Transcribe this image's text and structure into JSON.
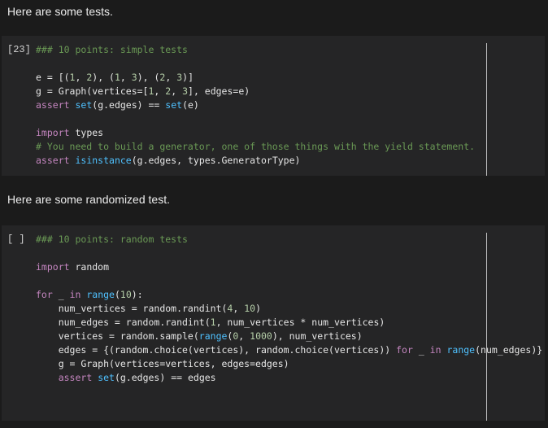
{
  "markdown_1": "Here are some tests.",
  "markdown_2": "Here are some randomized test.",
  "cell_1": {
    "prompt": "[23]",
    "lines": [
      [
        {
          "t": "### 10 points: simple tests",
          "c": "cm"
        }
      ],
      [],
      [
        {
          "t": "e = [(",
          "c": ""
        },
        {
          "t": "1",
          "c": "num"
        },
        {
          "t": ", ",
          "c": ""
        },
        {
          "t": "2",
          "c": "num"
        },
        {
          "t": "), (",
          "c": ""
        },
        {
          "t": "1",
          "c": "num"
        },
        {
          "t": ", ",
          "c": ""
        },
        {
          "t": "3",
          "c": "num"
        },
        {
          "t": "), (",
          "c": ""
        },
        {
          "t": "2",
          "c": "num"
        },
        {
          "t": ", ",
          "c": ""
        },
        {
          "t": "3",
          "c": "num"
        },
        {
          "t": ")]",
          "c": ""
        }
      ],
      [
        {
          "t": "g = Graph(vertices=[",
          "c": ""
        },
        {
          "t": "1",
          "c": "num"
        },
        {
          "t": ", ",
          "c": ""
        },
        {
          "t": "2",
          "c": "num"
        },
        {
          "t": ", ",
          "c": ""
        },
        {
          "t": "3",
          "c": "num"
        },
        {
          "t": "], edges=e)",
          "c": ""
        }
      ],
      [
        {
          "t": "assert",
          "c": "kw"
        },
        {
          "t": " ",
          "c": ""
        },
        {
          "t": "set",
          "c": "bi"
        },
        {
          "t": "(g.edges) == ",
          "c": ""
        },
        {
          "t": "set",
          "c": "bi"
        },
        {
          "t": "(e)",
          "c": ""
        }
      ],
      [],
      [
        {
          "t": "import",
          "c": "kw"
        },
        {
          "t": " types",
          "c": ""
        }
      ],
      [
        {
          "t": "# You need to build a generator, one of those things with the yield statement.",
          "c": "cm"
        }
      ],
      [
        {
          "t": "assert",
          "c": "kw"
        },
        {
          "t": " ",
          "c": ""
        },
        {
          "t": "isinstance",
          "c": "bi"
        },
        {
          "t": "(g.edges, types.GeneratorType)",
          "c": ""
        }
      ]
    ]
  },
  "cell_2": {
    "prompt": "[ ]",
    "lines": [
      [
        {
          "t": "### 10 points: random tests",
          "c": "cm"
        }
      ],
      [],
      [
        {
          "t": "import",
          "c": "kw"
        },
        {
          "t": " random",
          "c": ""
        }
      ],
      [],
      [
        {
          "t": "for",
          "c": "kw"
        },
        {
          "t": " _ ",
          "c": ""
        },
        {
          "t": "in",
          "c": "kw"
        },
        {
          "t": " ",
          "c": ""
        },
        {
          "t": "range",
          "c": "bi"
        },
        {
          "t": "(",
          "c": ""
        },
        {
          "t": "10",
          "c": "num"
        },
        {
          "t": "):",
          "c": ""
        }
      ],
      [
        {
          "t": "    num_vertices = random.randint(",
          "c": ""
        },
        {
          "t": "4",
          "c": "num"
        },
        {
          "t": ", ",
          "c": ""
        },
        {
          "t": "10",
          "c": "num"
        },
        {
          "t": ")",
          "c": ""
        }
      ],
      [
        {
          "t": "    num_edges = random.randint(",
          "c": ""
        },
        {
          "t": "1",
          "c": "num"
        },
        {
          "t": ", num_vertices * num_vertices)",
          "c": ""
        }
      ],
      [
        {
          "t": "    vertices = random.sample(",
          "c": ""
        },
        {
          "t": "range",
          "c": "bi"
        },
        {
          "t": "(",
          "c": ""
        },
        {
          "t": "0",
          "c": "num"
        },
        {
          "t": ", ",
          "c": ""
        },
        {
          "t": "1000",
          "c": "num"
        },
        {
          "t": "), num_vertices)",
          "c": ""
        }
      ],
      [
        {
          "t": "    edges = {(random.choice(vertices), random.choice(vertices)) ",
          "c": ""
        },
        {
          "t": "for",
          "c": "kw"
        },
        {
          "t": " _ ",
          "c": ""
        },
        {
          "t": "in",
          "c": "kw"
        },
        {
          "t": " ",
          "c": ""
        },
        {
          "t": "range",
          "c": "bi"
        },
        {
          "t": "(num_edges)}",
          "c": ""
        }
      ],
      [
        {
          "t": "    g = Graph(vertices=vertices, edges=edges)",
          "c": ""
        }
      ],
      [
        {
          "t": "    ",
          "c": ""
        },
        {
          "t": "assert",
          "c": "kw"
        },
        {
          "t": " ",
          "c": ""
        },
        {
          "t": "set",
          "c": "bi"
        },
        {
          "t": "(g.edges) == edges",
          "c": ""
        }
      ]
    ]
  }
}
